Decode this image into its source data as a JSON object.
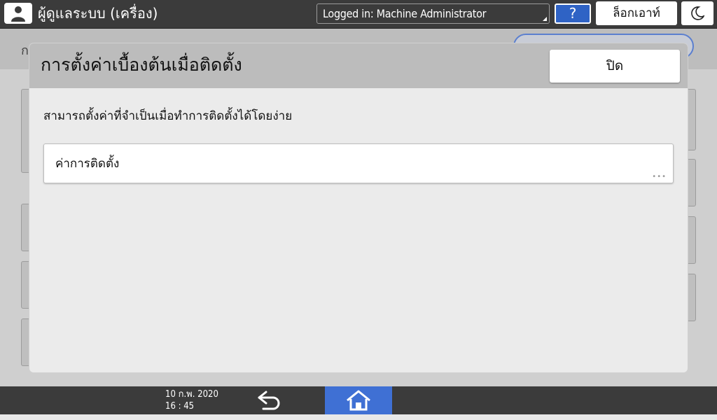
{
  "header": {
    "user_name": "ผู้ดูแลระบบ (เครื่อง)",
    "login_status": "Logged in: Machine Administrator",
    "help_label": "?",
    "logout_label": "ล็อกเอาท์"
  },
  "background": {
    "title_fragment": "ก"
  },
  "dialog": {
    "title": "การตั้งค่าเบื้องต้นเมื่อติดตั้ง",
    "close_label": "ปิด",
    "description": "สามารถตั้งค่าที่จำเป็นเมื่อทำการติดตั้งได้โดยง่าย",
    "items": [
      {
        "label": "ค่าการติดตั้ง",
        "more": "•••"
      }
    ]
  },
  "footer": {
    "date": "10 ก.พ. 2020",
    "time": "16 : 45"
  },
  "colors": {
    "accent_blue": "#3f70d4",
    "topbar": "#3b3b3b",
    "dialog_header": "#bcbcbc"
  },
  "icons": [
    "user-icon",
    "energy-saver-icon",
    "back-icon",
    "home-icon",
    "more-icon"
  ]
}
